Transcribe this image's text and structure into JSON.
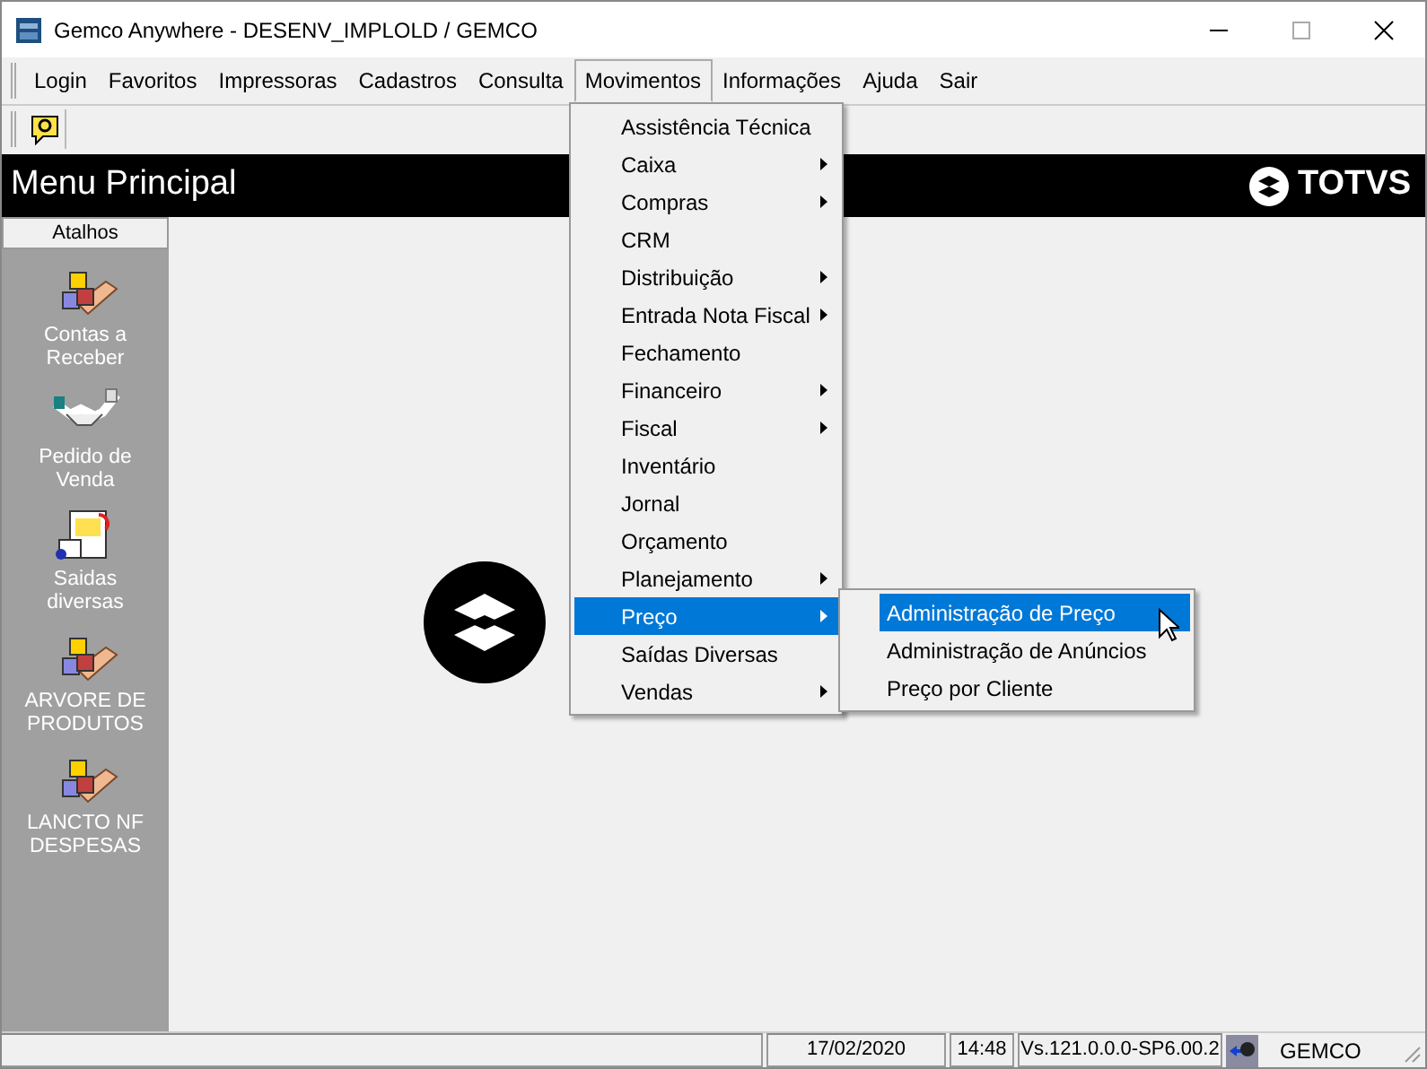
{
  "window": {
    "title": "Gemco Anywhere - DESENV_IMPLOLD / GEMCO"
  },
  "menu_bar": [
    {
      "label": "Login",
      "selected": false
    },
    {
      "label": "Favoritos",
      "selected": false
    },
    {
      "label": "Impressoras",
      "selected": false
    },
    {
      "label": "Cadastros",
      "selected": false
    },
    {
      "label": "Consulta",
      "selected": false
    },
    {
      "label": "Movimentos",
      "selected": true
    },
    {
      "label": "Informações",
      "selected": false
    },
    {
      "label": "Ajuda",
      "selected": false
    },
    {
      "label": "Sair",
      "selected": false
    }
  ],
  "header": {
    "title": "Menu Principal",
    "brand": "TOTVS"
  },
  "sidebar": {
    "title": "Atalhos",
    "items": [
      {
        "label": "Contas a Receber",
        "kind": "blocks"
      },
      {
        "label": "Pedido de Venda",
        "kind": "handshake"
      },
      {
        "label": "Saidas diversas",
        "kind": "document"
      },
      {
        "label": "ARVORE DE PRODUTOS",
        "kind": "blocks"
      },
      {
        "label": "LANCTO NF DESPESAS",
        "kind": "blocks"
      }
    ]
  },
  "dropdown": [
    {
      "label": "Assistência Técnica",
      "submenu": false,
      "selected": false
    },
    {
      "label": "Caixa",
      "submenu": true,
      "selected": false
    },
    {
      "label": "Compras",
      "submenu": true,
      "selected": false
    },
    {
      "label": "CRM",
      "submenu": false,
      "selected": false
    },
    {
      "label": "Distribuição",
      "submenu": true,
      "selected": false
    },
    {
      "label": "Entrada Nota Fiscal",
      "submenu": true,
      "selected": false
    },
    {
      "label": "Fechamento",
      "submenu": false,
      "selected": false
    },
    {
      "label": "Financeiro",
      "submenu": true,
      "selected": false
    },
    {
      "label": "Fiscal",
      "submenu": true,
      "selected": false
    },
    {
      "label": "Inventário",
      "submenu": false,
      "selected": false
    },
    {
      "label": "Jornal",
      "submenu": false,
      "selected": false
    },
    {
      "label": "Orçamento",
      "submenu": false,
      "selected": false
    },
    {
      "label": "Planejamento",
      "submenu": true,
      "selected": false
    },
    {
      "label": "Preço",
      "submenu": true,
      "selected": true
    },
    {
      "label": "Saídas Diversas",
      "submenu": false,
      "selected": false
    },
    {
      "label": "Vendas",
      "submenu": true,
      "selected": false
    }
  ],
  "submenu": [
    {
      "label": "Administração de Preço",
      "selected": true
    },
    {
      "label": "Administração de Anúncios",
      "selected": false
    },
    {
      "label": "Preço por Cliente",
      "selected": false
    }
  ],
  "status_bar": [
    "17/02/2020",
    "14:48",
    "Vs.121.0.0.0-SP6.00.2",
    "GEMCO"
  ]
}
